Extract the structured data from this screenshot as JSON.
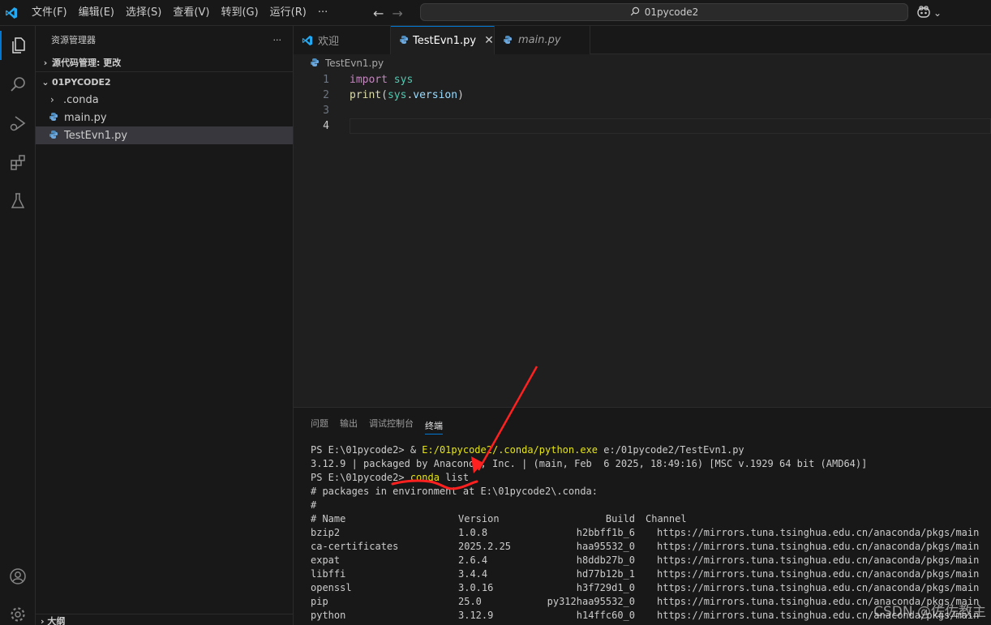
{
  "titlebar": {
    "menu": [
      "文件(F)",
      "编辑(E)",
      "选择(S)",
      "查看(V)",
      "转到(G)",
      "运行(R)",
      "···"
    ],
    "search_text": "01pycode2",
    "copilot_chevron": "⌄"
  },
  "sidebar": {
    "title": "资源管理器",
    "more": "···",
    "source_control": "源代码管理: 更改",
    "workspace": "01PYCODE2",
    "items": [
      {
        "label": ".conda",
        "type": "folder"
      },
      {
        "label": "main.py",
        "type": "python"
      },
      {
        "label": "TestEvn1.py",
        "type": "python",
        "selected": true
      }
    ],
    "bottom_section": "大纲"
  },
  "editor": {
    "tabs": [
      {
        "label": "欢迎",
        "icon": "vscode-icon"
      },
      {
        "label": "TestEvn1.py",
        "icon": "python-icon",
        "active": true,
        "close": "✕"
      },
      {
        "label": "main.py",
        "icon": "python-icon",
        "italic": true
      }
    ],
    "breadcrumb": "TestEvn1.py",
    "line_numbers": [
      "1",
      "2",
      "3",
      "4"
    ],
    "code": {
      "line1_kw": "import",
      "line1_mod": "sys",
      "line2_fn": "print",
      "line2_open": "(",
      "line2_obj": "sys",
      "line2_dot": ".",
      "line2_attr": "version",
      "line2_close": ")"
    }
  },
  "panel": {
    "tabs": [
      "问题",
      "输出",
      "调试控制台",
      "终端"
    ],
    "active_tab": "终端",
    "terminal": {
      "line1_prompt": "PS E:\\01pycode2> ",
      "line1_amp": "& ",
      "line1_exe": "E:/01pycode2/.conda/python.exe",
      "line1_arg": " e:/01pycode2/TestEvn1.py",
      "line2": "3.12.9 | packaged by Anaconda, Inc. | (main, Feb  6 2025, 18:49:16) [MSC v.1929 64 bit (AMD64)]",
      "line3_prompt": "PS E:\\01pycode2> ",
      "line3_cmd": "conda",
      "line3_arg": " list",
      "line4": "# packages in environment at E:\\01pycode2\\.conda:",
      "line5": "#",
      "header": {
        "name": "# Name",
        "version": "Version",
        "build": "Build",
        "channel": "Channel"
      },
      "packages": [
        {
          "name": "bzip2",
          "version": "1.0.8",
          "build": "h2bbff1b_6",
          "channel": "https://mirrors.tuna.tsinghua.edu.cn/anaconda/pkgs/main"
        },
        {
          "name": "ca-certificates",
          "version": "2025.2.25",
          "build": "haa95532_0",
          "channel": "https://mirrors.tuna.tsinghua.edu.cn/anaconda/pkgs/main"
        },
        {
          "name": "expat",
          "version": "2.6.4",
          "build": "h8ddb27b_0",
          "channel": "https://mirrors.tuna.tsinghua.edu.cn/anaconda/pkgs/main"
        },
        {
          "name": "libffi",
          "version": "3.4.4",
          "build": "hd77b12b_1",
          "channel": "https://mirrors.tuna.tsinghua.edu.cn/anaconda/pkgs/main"
        },
        {
          "name": "openssl",
          "version": "3.0.16",
          "build": "h3f729d1_0",
          "channel": "https://mirrors.tuna.tsinghua.edu.cn/anaconda/pkgs/main"
        },
        {
          "name": "pip",
          "version": "25.0",
          "build": "py312haa95532_0",
          "channel": "https://mirrors.tuna.tsinghua.edu.cn/anaconda/pkgs/main"
        },
        {
          "name": "python",
          "version": "3.12.9",
          "build": "h14ffc60_0",
          "channel": "https://mirrors.tuna.tsinghua.edu.cn/anaconda/pkgs/main"
        }
      ]
    }
  },
  "watermark": "CSDN @佐佐教主",
  "colors": {
    "accent": "#0078d4",
    "annotation": "#ff2020"
  }
}
